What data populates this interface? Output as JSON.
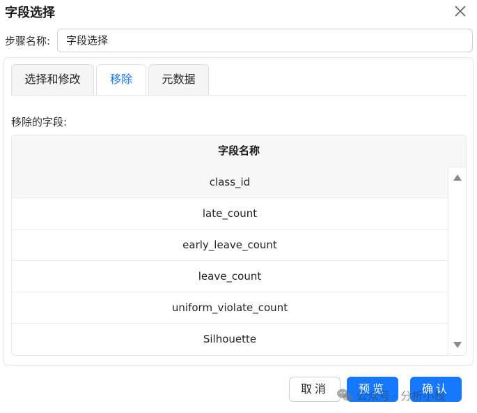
{
  "dialog": {
    "title": "字段选择",
    "close_icon": "close-icon"
  },
  "step": {
    "label": "步骤名称:",
    "value": "字段选择"
  },
  "tabs": [
    {
      "label": "选择和修改",
      "active": false
    },
    {
      "label": "移除",
      "active": true
    },
    {
      "label": "元数据",
      "active": false
    }
  ],
  "removed_section": {
    "label": "移除的字段:",
    "column_header": "字段名称",
    "rows": [
      "class_id",
      "late_count",
      "early_leave_count",
      "leave_count",
      "uniform_violate_count",
      "Silhouette"
    ]
  },
  "buttons": {
    "cancel": "取消",
    "preview": "预览",
    "confirm": "确认"
  },
  "watermark": {
    "text": "公众号 · 分析小栈",
    "icon": "wechat-icon"
  },
  "colors": {
    "accent": "#1677ff",
    "header_bg": "#f7f7f7"
  }
}
